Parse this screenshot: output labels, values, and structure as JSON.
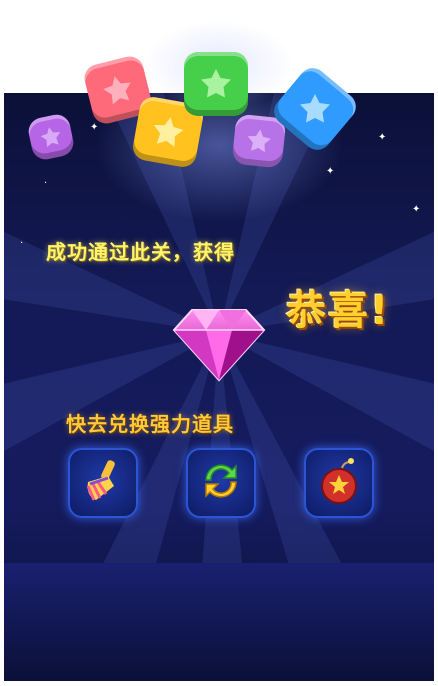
{
  "popup": {
    "subtitle": "成功通过此关，获得",
    "congrats": "恭喜!",
    "prompt": "快去兑换强力道具"
  },
  "reward": {
    "icon": "diamond-icon",
    "color": "#e83cc8"
  },
  "blocks": [
    {
      "name": "purple-block-icon",
      "color": "#b565e6"
    },
    {
      "name": "red-block-icon",
      "color": "#ff6a7a"
    },
    {
      "name": "yellow-block-icon",
      "color": "#ffc21f"
    },
    {
      "name": "green-block-icon",
      "color": "#46cf4a"
    },
    {
      "name": "violet-block-icon",
      "color": "#b872e8"
    },
    {
      "name": "blue-block-icon",
      "color": "#2f9bff"
    }
  ],
  "tools": [
    {
      "name": "brush-tool-icon"
    },
    {
      "name": "refresh-tool-icon"
    },
    {
      "name": "bomb-tool-icon"
    }
  ]
}
